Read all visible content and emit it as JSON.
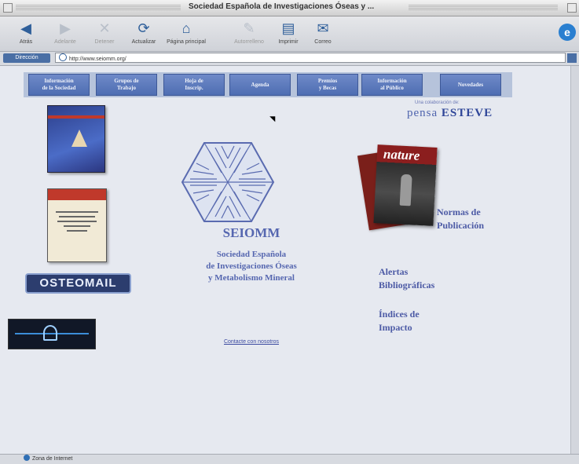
{
  "window": {
    "title": "Sociedad Española de Investigaciones Óseas y ..."
  },
  "toolbar": {
    "buttons": [
      {
        "label": "Atrás",
        "icon": "back-arrow-icon"
      },
      {
        "label": "Adelante",
        "icon": "forward-arrow-icon"
      },
      {
        "label": "Detener",
        "icon": "stop-icon"
      },
      {
        "label": "Actualizar",
        "icon": "refresh-icon"
      },
      {
        "label": "Página principal",
        "icon": "home-icon"
      },
      {
        "label": "Autorrelleno",
        "icon": "autofill-icon"
      },
      {
        "label": "Imprimir",
        "icon": "print-icon"
      },
      {
        "label": "Correo",
        "icon": "mail-icon"
      }
    ]
  },
  "address": {
    "label": "Dirección",
    "url": "http://www.seiomm.org/"
  },
  "nav": {
    "items": [
      "Información\nde la Sociedad",
      "Grupos de\nTrabajo",
      "Hoja de\nInscrip.",
      "Agenda",
      "Premios\ny Becas",
      "Información\nal Público",
      "Novedades"
    ]
  },
  "left": {
    "osteo_banner": "OSTEOMAIL"
  },
  "center": {
    "brand": "SEIOMM",
    "subtitle": [
      "Sociedad Española",
      "de Investigaciones Óseas",
      "y Metabolismo Mineral"
    ],
    "contact": "Contacte con nosotros"
  },
  "right": {
    "collab_small": "Una colaboración de:",
    "collab_brand_prefix": "pensa",
    "collab_brand_main": "ESTEVE",
    "journal": "nature",
    "links": {
      "normas": [
        "Normas de",
        "Publicación"
      ],
      "alertas": [
        "Alertas",
        "Bibliográficas"
      ],
      "indices": [
        "Índices de",
        "Impacto"
      ]
    }
  },
  "status": {
    "text": "Zona de Internet"
  },
  "colors": {
    "nav_button": "#5a78bb",
    "link_text": "#4c5aa5",
    "page_bg": "#e6e9f0"
  }
}
